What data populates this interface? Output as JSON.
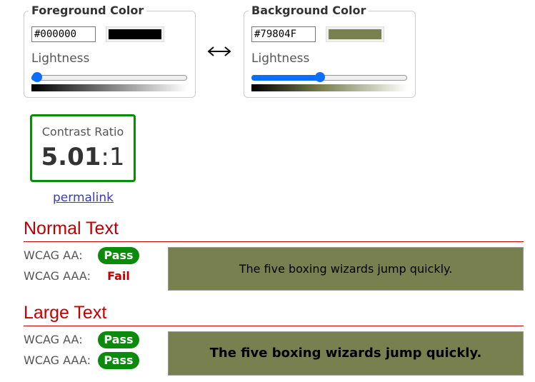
{
  "foreground": {
    "legend": "Foreground Color",
    "hex": "#000000",
    "color": "#000000",
    "lightness_label": "Lightness",
    "lightness": 0
  },
  "background": {
    "legend": "Background Color",
    "hex": "#79804F",
    "color": "#79804f",
    "lightness_label": "Lightness",
    "lightness": 0.43
  },
  "swap_icon": "left-right-arrow-icon",
  "contrast": {
    "label": "Contrast Ratio",
    "value": "5.01",
    "suffix": ":1"
  },
  "permalink": "permalink",
  "normal_text": {
    "title": "Normal Text",
    "aa_label": "WCAG AA:",
    "aa_result": "Pass",
    "aaa_label": "WCAG AAA:",
    "aaa_result": "Fail",
    "sample": "The five boxing wizards jump quickly."
  },
  "large_text": {
    "title": "Large Text",
    "aa_label": "WCAG AA:",
    "aa_result": "Pass",
    "aaa_label": "WCAG AAA:",
    "aaa_result": "Pass",
    "sample": "The five boxing wizards jump quickly."
  },
  "colors": {
    "pass": "#0b8a0b",
    "fail": "#c00000",
    "accent": "#0d6efd"
  }
}
